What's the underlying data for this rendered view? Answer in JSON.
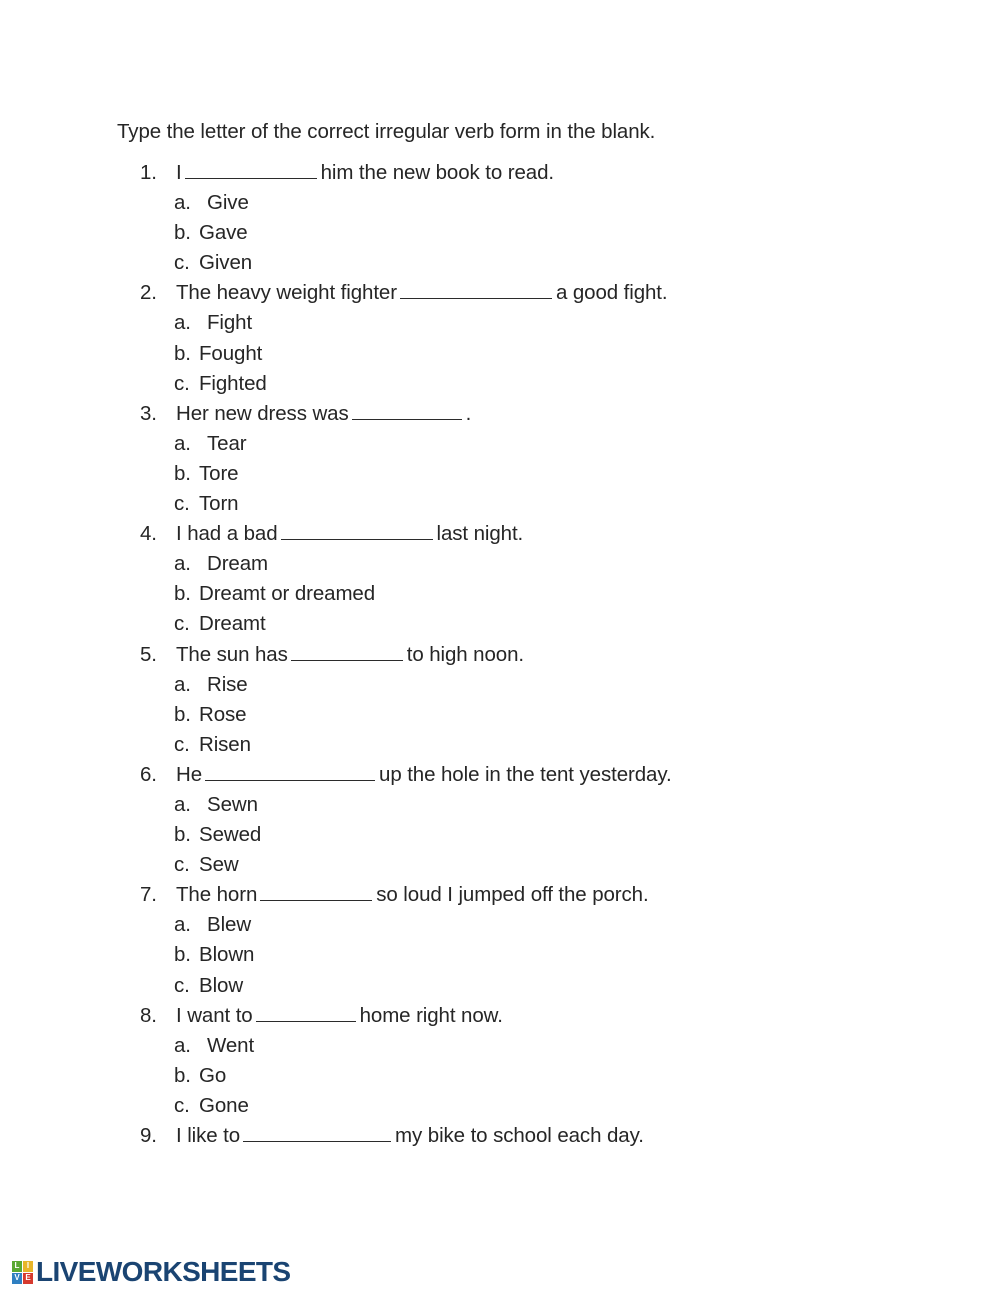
{
  "worksheet": {
    "instruction": "Type the letter of the correct irregular verb form in the blank.",
    "questions": [
      {
        "number": "1.",
        "pre": "I",
        "blank_width": 132,
        "post": "him the new book to read.",
        "options": [
          {
            "letter": "a.",
            "text": "Give"
          },
          {
            "letter": "b.",
            "text": "Gave"
          },
          {
            "letter": "c.",
            "text": "Given"
          }
        ]
      },
      {
        "number": "2.",
        "pre": "The heavy weight fighter",
        "blank_width": 152,
        "post": "a good fight.",
        "options": [
          {
            "letter": "a.",
            "text": "Fight"
          },
          {
            "letter": "b.",
            "text": "Fought"
          },
          {
            "letter": "c.",
            "text": "Fighted"
          }
        ]
      },
      {
        "number": "3.",
        "pre": "Her new dress was",
        "blank_width": 110,
        "post": ".",
        "options": [
          {
            "letter": "a.",
            "text": "Tear"
          },
          {
            "letter": "b.",
            "text": "Tore"
          },
          {
            "letter": "c.",
            "text": "Torn"
          }
        ]
      },
      {
        "number": "4.",
        "pre": "I had a bad",
        "blank_width": 152,
        "post": "last night.",
        "options": [
          {
            "letter": "a.",
            "text": "Dream"
          },
          {
            "letter": "b.",
            "text": "Dreamt or dreamed"
          },
          {
            "letter": "c.",
            "text": "Dreamt"
          }
        ]
      },
      {
        "number": "5.",
        "pre": "The sun has",
        "blank_width": 112,
        "post": "to high noon.",
        "options": [
          {
            "letter": "a.",
            "text": "Rise"
          },
          {
            "letter": "b.",
            "text": "Rose"
          },
          {
            "letter": "c.",
            "text": "Risen"
          }
        ]
      },
      {
        "number": "6.",
        "pre": "He",
        "blank_width": 170,
        "post": "up the hole in the tent yesterday.",
        "options": [
          {
            "letter": "a.",
            "text": "Sewn"
          },
          {
            "letter": "b.",
            "text": "Sewed"
          },
          {
            "letter": "c.",
            "text": "Sew"
          }
        ]
      },
      {
        "number": "7.",
        "pre": "The horn",
        "blank_width": 112,
        "post": "so loud I jumped off the porch.",
        "options": [
          {
            "letter": "a.",
            "text": "Blew"
          },
          {
            "letter": "b.",
            "text": "Blown"
          },
          {
            "letter": "c.",
            "text": "Blow"
          }
        ]
      },
      {
        "number": "8.",
        "pre": "I want to",
        "blank_width": 100,
        "post": "home right now.",
        "options": [
          {
            "letter": "a.",
            "text": "Went"
          },
          {
            "letter": "b.",
            "text": "Go"
          },
          {
            "letter": "c.",
            "text": "Gone"
          }
        ]
      },
      {
        "number": "9.",
        "pre": "I like to",
        "blank_width": 148,
        "post": "my bike to school each day.",
        "options": []
      }
    ]
  },
  "footer": {
    "brand_name": "LIVEWORKSHEETS",
    "brand_mark_letters": [
      "L",
      "I",
      "V",
      "E"
    ],
    "brand_text_color": "#1a4472",
    "brand_mark_colors": [
      "#5aa832",
      "#e8b52a",
      "#2f7fc1",
      "#d63a2f"
    ]
  }
}
